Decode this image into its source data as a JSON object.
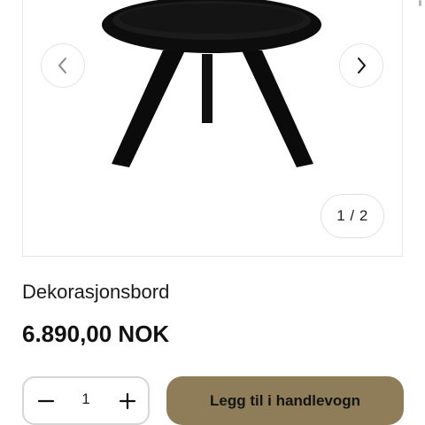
{
  "product": {
    "title": "Dekorasjonsbord",
    "price": "6.890,00 NOK"
  },
  "gallery": {
    "counter": "1 / 2",
    "prev_icon": "chevron-left-icon",
    "next_icon": "chevron-right-icon"
  },
  "quantity": {
    "value": "1",
    "decrease_icon": "minus-icon",
    "increase_icon": "plus-icon"
  },
  "cart": {
    "add_label": "Legg til i handlevogn",
    "button_color": "#8e7d58"
  }
}
